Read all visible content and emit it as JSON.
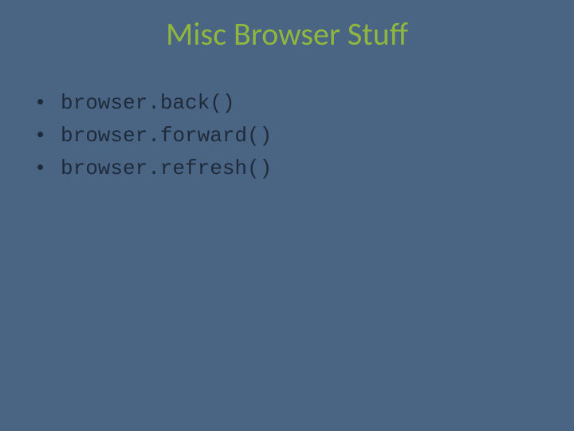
{
  "title": "Misc Browser Stuff",
  "bullets": [
    {
      "text": "browser.back()"
    },
    {
      "text": "browser.forward()"
    },
    {
      "text": "browser.refresh()"
    }
  ],
  "bullet_char": "•",
  "colors": {
    "background": "#4a6484",
    "title": "#8fb63f",
    "body": "#1f2b3a"
  }
}
